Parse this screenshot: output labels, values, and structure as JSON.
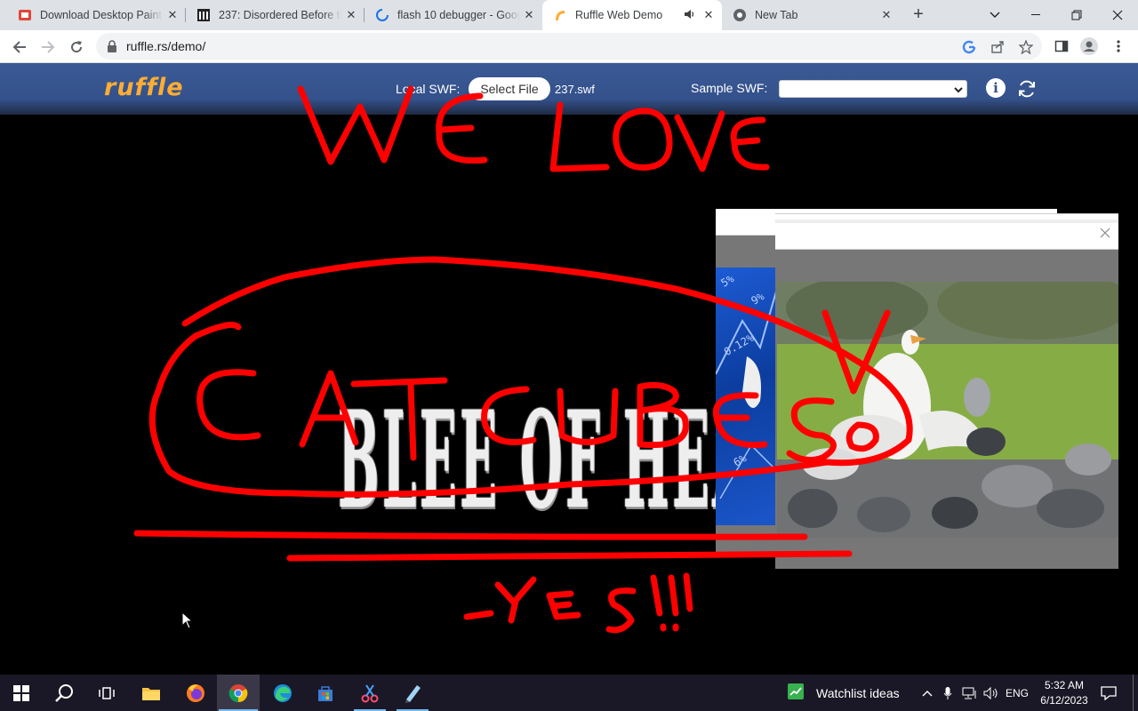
{
  "browser": {
    "tabs": [
      {
        "title": "Download Desktop Painter",
        "favicon": "painter-icon"
      },
      {
        "title": "237: Disordered Before the",
        "favicon": "archive-icon"
      },
      {
        "title": "flash 10 debugger - Google",
        "favicon": "loading-icon"
      },
      {
        "title": "Ruffle Web Demo",
        "favicon": "ruffle-icon",
        "active": true,
        "audio": true
      },
      {
        "title": "New Tab",
        "favicon": "chrome-icon"
      }
    ],
    "url": "ruffle.rs/demo/"
  },
  "ruffle": {
    "logo": "ruffle",
    "local_swf_label": "Local SWF:",
    "select_file_label": "Select File",
    "file_name": "237.swf",
    "sample_swf_label": "Sample SWF:",
    "sample_selected": "",
    "info_label": "i"
  },
  "content": {
    "gothic_text": "BLEE OF HEA",
    "stock_numbers": [
      "5%",
      "0.12%",
      "9%",
      "6%"
    ]
  },
  "taskbar": {
    "watchlist_label": "Watchlist ideas",
    "language": "ENG",
    "time": "5:32 AM",
    "date": "6/12/2023"
  },
  "colors": {
    "ruffle_header": "#34518b",
    "ruffle_logo": "#ffad33",
    "ink": "#ff0000",
    "taskbar": "#1a1826"
  }
}
